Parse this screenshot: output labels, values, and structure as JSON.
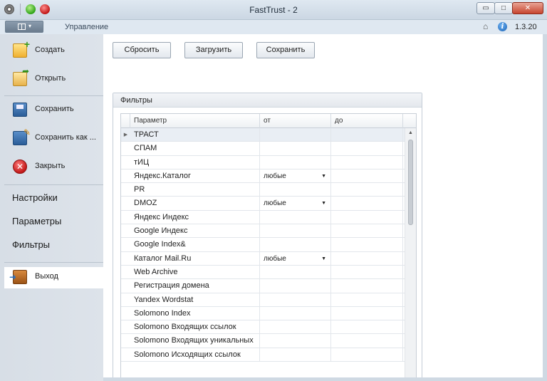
{
  "window": {
    "title": "FastTrust - 2",
    "minimize_glyph": "▭",
    "maximize_glyph": "□",
    "close_glyph": "✕"
  },
  "ribbon": {
    "tab_label": "Управление",
    "version": "1.3.20",
    "menu_arrow": "▾"
  },
  "sidebar": {
    "items": [
      {
        "label": "Создать",
        "icon": "create-icon"
      },
      {
        "label": "Открыть",
        "icon": "open-icon"
      },
      {
        "label": "Сохранить",
        "icon": "save-icon"
      },
      {
        "label": "Сохранить как ...",
        "icon": "save-as-icon"
      },
      {
        "label": "Закрыть",
        "icon": "close-icon",
        "glyph": "✕"
      }
    ],
    "sections": [
      "Настройки",
      "Параметры",
      "Фильтры"
    ],
    "active_section": "Фильтры",
    "exit": {
      "label": "Выход",
      "icon": "exit-icon"
    }
  },
  "toolbar": {
    "reset_label": "Сбросить",
    "load_label": "Загрузить",
    "save_label": "Сохранить"
  },
  "filters": {
    "title": "Фильтры",
    "columns": [
      "Параметр",
      "от",
      "до"
    ],
    "rows": [
      {
        "param": "ТРАСТ",
        "from": "",
        "to": ""
      },
      {
        "param": "СПАМ",
        "from": "",
        "to": ""
      },
      {
        "param": "тИЦ",
        "from": "",
        "to": ""
      },
      {
        "param": "Яндекс.Каталог",
        "from": "любые",
        "to": ""
      },
      {
        "param": "PR",
        "from": "",
        "to": ""
      },
      {
        "param": "DMOZ",
        "from": "любые",
        "to": ""
      },
      {
        "param": "Яндекс Индекс",
        "from": "",
        "to": ""
      },
      {
        "param": "Google Индекс",
        "from": "",
        "to": ""
      },
      {
        "param": "Google Index&",
        "from": "",
        "to": ""
      },
      {
        "param": "Каталог Mail.Ru",
        "from": "любые",
        "to": ""
      },
      {
        "param": "Web Archive",
        "from": "",
        "to": ""
      },
      {
        "param": "Регистрация домена",
        "from": "",
        "to": ""
      },
      {
        "param": "Yandex Wordstat",
        "from": "",
        "to": ""
      },
      {
        "param": "Solomono Index",
        "from": "",
        "to": ""
      },
      {
        "param": "Solomono Входящих ссылок",
        "from": "",
        "to": ""
      },
      {
        "param": "Solomono Входящих уникальных",
        "from": "",
        "to": ""
      },
      {
        "param": "Solomono Исходящих ссылок",
        "from": "",
        "to": ""
      }
    ],
    "selected_row_indicator": "▶",
    "dropdown_arrow": "▼",
    "scroll_up": "▲",
    "scroll_down": "▼"
  }
}
